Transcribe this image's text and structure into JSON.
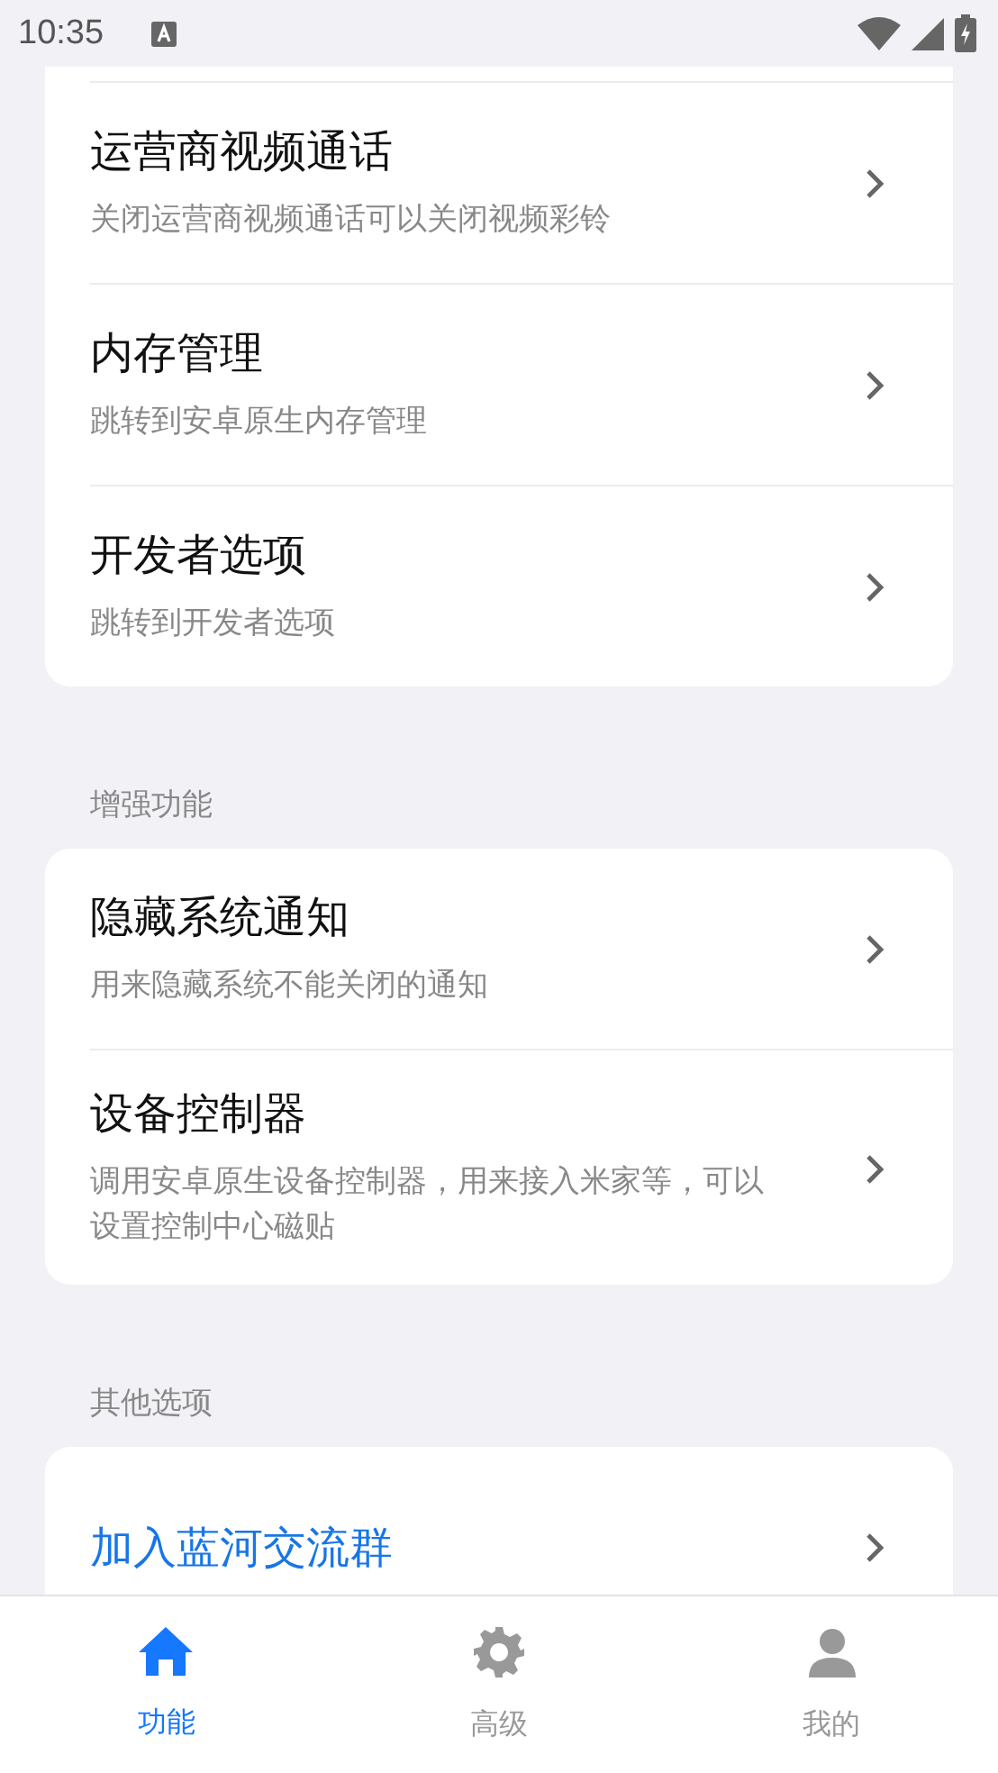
{
  "status_bar": {
    "time": "10:35"
  },
  "sections": [
    {
      "items": [
        {
          "kind": "setting",
          "title": "运营商视频通话",
          "subtitle": "关闭运营商视频通话可以关闭视频彩铃"
        },
        {
          "kind": "setting",
          "title": "内存管理",
          "subtitle": "跳转到安卓原生内存管理"
        },
        {
          "kind": "setting",
          "title": "开发者选项",
          "subtitle": "跳转到开发者选项"
        }
      ]
    },
    {
      "header": "增强功能",
      "items": [
        {
          "kind": "setting",
          "title": "隐藏系统通知",
          "subtitle": "用来隐藏系统不能关闭的通知"
        },
        {
          "kind": "setting",
          "title": "设备控制器",
          "subtitle": "调用安卓原生设备控制器，用来接入米家等，可以设置控制中心磁贴"
        }
      ]
    },
    {
      "header": "其他选项",
      "items": [
        {
          "kind": "link",
          "title": "加入蓝河交流群"
        }
      ]
    }
  ],
  "bottom_nav": [
    {
      "kind": "home",
      "label": "功能",
      "selected": true
    },
    {
      "kind": "gear",
      "label": "高级",
      "selected": false
    },
    {
      "kind": "person",
      "label": "我的",
      "selected": false
    }
  ]
}
